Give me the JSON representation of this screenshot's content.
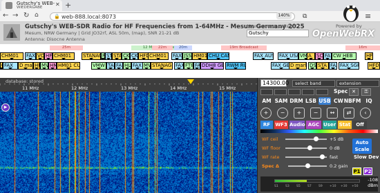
{
  "browser": {
    "tab_title": "Gutschy's WEB-",
    "tab_subtitle": "WIEDERGABE",
    "url": "web-888.local:8073",
    "zoom": "140%"
  },
  "header": {
    "title": "Gutschy's WEB-SDR Radio for HF Frequencies from 1-64MHz - Mesum Germany 2025",
    "location": "Mesum, NRW Germany | Grid JO32rf, ASL 50m, (map), SNR 21-21 dB",
    "antenna": "Antenna: Disocne Antenna",
    "callsign_prompt": "Your name or callsign:",
    "callsign_value": "Gutschy",
    "powered_by": "Powered by",
    "brand": "OpenWebRX"
  },
  "bands": [
    {
      "label": "25m",
      "kind": "r"
    },
    {
      "label": "12 MHz Maritime",
      "kind": "g"
    },
    {
      "label": "22m",
      "kind": "r"
    },
    {
      "label": "20m",
      "kind": "b"
    },
    {
      "label": "19m Broadcast",
      "kind": "r"
    },
    {
      "label": "16m",
      "kind": "r"
    }
  ],
  "bookmarks": [
    {
      "label": "CHM01",
      "color": "#ffd54f"
    },
    {
      "label": "FAX",
      "color": "#a8e6ff"
    },
    {
      "label": "VC",
      "color": "#ffd54f"
    },
    {
      "label": "HF",
      "color": "#ff9ad5"
    },
    {
      "label": "CHM01",
      "color": "#ffd54f"
    },
    {
      "label": "STANAG",
      "color": "#ffd54f"
    },
    {
      "label": "F",
      "color": "#b7ffb0"
    },
    {
      "label": "ST",
      "color": "#a8e6ff"
    },
    {
      "label": "STA",
      "color": "#ffd54f"
    },
    {
      "label": "CKS",
      "color": "#b7ffb0"
    },
    {
      "label": "CK",
      "color": "#a8e6ff"
    },
    {
      "label": "HFD",
      "color": "#ffd54f"
    },
    {
      "label": "CHM01",
      "color": "#ffd54f"
    },
    {
      "label": "FAX",
      "color": "#a8e6ff"
    },
    {
      "label": "JSS",
      "color": "#b7ffb0"
    },
    {
      "label": "HM01",
      "color": "#ffd54f"
    },
    {
      "label": "CHU CAN",
      "color": "#4fc3f7"
    },
    {
      "label": "FAX AUS",
      "color": "#a8e6ff"
    },
    {
      "label": "FAX USA",
      "color": "#a8e6ff"
    },
    {
      "label": "VMW",
      "color": "#b7ffb0"
    },
    {
      "label": "A",
      "color": "#ffd54f"
    },
    {
      "label": "SC",
      "color": "#ff9ad5"
    },
    {
      "label": "FA",
      "color": "#a8e6ff"
    },
    {
      "label": "CW HEB",
      "color": "#b7ffb0"
    },
    {
      "label": "HF",
      "color": "#ffd54f"
    },
    {
      "label": "CHM",
      "color": "#ffd54f"
    },
    {
      "label": "FAX",
      "color": "#a8e6ff"
    },
    {
      "label": "AU",
      "color": "#a8e6ff"
    },
    {
      "label": "D marker",
      "color": "#ffd54f"
    },
    {
      "label": "HF",
      "color": "#ffd54f"
    },
    {
      "label": "MV",
      "color": "#b7ffb0"
    },
    {
      "label": "HM",
      "color": "#ff9ad5"
    },
    {
      "label": "HM01 CUB",
      "color": "#ffd54f"
    },
    {
      "label": "VMW",
      "color": "#b7ffb0"
    },
    {
      "label": "TA",
      "color": "#a8e6ff"
    },
    {
      "label": "FA",
      "color": "#a8e6ff"
    },
    {
      "label": "HL",
      "color": "#b7ffb0"
    },
    {
      "label": "FAX",
      "color": "#a8e6ff"
    },
    {
      "label": "MV",
      "color": "#b7ffb0"
    },
    {
      "label": "STANAG F",
      "color": "#ffd54f"
    },
    {
      "label": "FAX",
      "color": "#a8e6ff"
    },
    {
      "label": "FT8",
      "color": "#b7ffb0"
    },
    {
      "label": "FA",
      "color": "#a8e6ff"
    },
    {
      "label": "DDH8 GER",
      "color": "#d09bff"
    },
    {
      "label": "RWM RUS",
      "color": "#4fc3f7"
    },
    {
      "label": "FAX GE",
      "color": "#a8e6ff"
    },
    {
      "label": "D marker",
      "color": "#ffd54f"
    },
    {
      "label": "DS",
      "color": "#b7ffb0"
    },
    {
      "label": "STA",
      "color": "#ffd54f"
    },
    {
      "label": "FAX",
      "color": "#a8e6ff"
    },
    {
      "label": "FAX SGP",
      "color": "#a8e6ff"
    },
    {
      "label": "HFD",
      "color": "#ffd54f"
    }
  ],
  "scale": {
    "info": "database: stored",
    "ticks": [
      "11 MHz",
      "12 MHz",
      "13 MHz",
      "14 MHz",
      "15 MHz"
    ]
  },
  "panel": {
    "frequency": "14300.00",
    "unit": "Hz",
    "band_select": "select band",
    "extension_select": "extension",
    "spec_label": "Spec",
    "modes": [
      "AM",
      "SAM",
      "DRM",
      "LSB",
      "USB",
      "CW",
      "NBFM",
      "IQ"
    ],
    "active_mode": "USB",
    "toggles": [
      {
        "label": "RF",
        "bg": "#2e86de"
      },
      {
        "label": "WF3",
        "bg": "#e53935"
      },
      {
        "label": "Audio",
        "bg": "#7e57c2"
      },
      {
        "label": "AGC",
        "bg": "#ab47bc"
      },
      {
        "label": "User",
        "bg": "#26a69a"
      },
      {
        "label": "Stat",
        "bg": "#fbc02d"
      },
      {
        "label": "Off",
        "bg": "#424242"
      }
    ],
    "sliders": [
      {
        "label": "WF ceil",
        "value": "+5 dB",
        "pos": 0.78
      },
      {
        "label": "WF floor",
        "value": "0 dB",
        "pos": 0.6
      },
      {
        "label": "WF rate",
        "value": "fast",
        "pos": 0.95
      },
      {
        "label": "Spec Δ",
        "value": "0.2 gain",
        "pos": 0.5
      }
    ],
    "autoscale": "Auto Scale",
    "slowdev": "Slow Dev",
    "p1": "P1",
    "p2": "P2",
    "meter": {
      "db": "-108 dBm",
      "ticks": [
        "S1",
        "S3",
        "S5",
        "S7",
        "S9",
        "+10",
        "+30",
        "+50"
      ],
      "level": 0.38
    }
  }
}
